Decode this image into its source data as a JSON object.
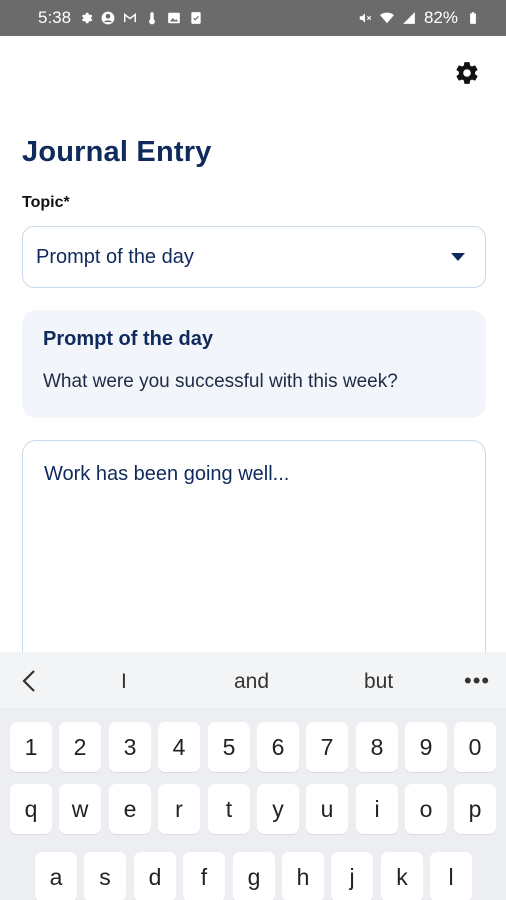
{
  "status_bar": {
    "time": "5:38",
    "battery": "82%",
    "left_icons": [
      "settings-icon",
      "account-icon",
      "gmail-icon",
      "thermometer-icon",
      "image-icon",
      "tasks-icon"
    ],
    "right_icons": [
      "mute-icon",
      "wifi-icon",
      "signal-icon",
      "battery-icon"
    ]
  },
  "header": {
    "settings_icon": "gear-icon"
  },
  "page": {
    "title": "Journal Entry",
    "topic_label": "Topic*",
    "topic_value": "Prompt of the day"
  },
  "prompt_card": {
    "title": "Prompt of the day",
    "text": "What were you successful with this week?"
  },
  "entry": {
    "text": "Work has been going well..."
  },
  "keyboard": {
    "suggestions": [
      "I",
      "and",
      "but"
    ],
    "more_icon": "ellipsis-icon",
    "back_icon": "chevron-left-icon",
    "number_row": [
      "1",
      "2",
      "3",
      "4",
      "5",
      "6",
      "7",
      "8",
      "9",
      "0"
    ],
    "row1": [
      "q",
      "w",
      "e",
      "r",
      "t",
      "y",
      "u",
      "i",
      "o",
      "p"
    ],
    "row2": [
      "a",
      "s",
      "d",
      "f",
      "g",
      "h",
      "j",
      "k",
      "l"
    ]
  },
  "colors": {
    "primary": "#0f2a5c",
    "status_bar": "#6b6b6b",
    "card_bg": "#f2f6fa",
    "border": "#c9d9e8",
    "keyboard_bg": "#eceef1"
  }
}
